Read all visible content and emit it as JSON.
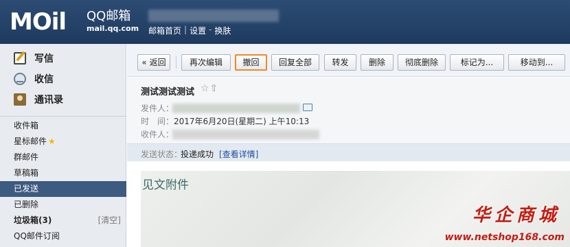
{
  "brand": {
    "logo": "MOil",
    "title": "QQ邮箱",
    "domain": "mail.qq.com"
  },
  "header": {
    "links": [
      "邮箱首页",
      "|",
      "设置",
      "-",
      "换肤"
    ]
  },
  "sidebar": {
    "actions": [
      {
        "label": "写信",
        "icon": "compose-icon"
      },
      {
        "label": "收信",
        "icon": "inbox-icon"
      },
      {
        "label": "通讯录",
        "icon": "contacts-icon"
      }
    ],
    "folders": [
      {
        "label": "收件箱"
      },
      {
        "label": "星标邮件",
        "star": "★"
      },
      {
        "label": "群邮件"
      },
      {
        "label": "草稿箱"
      },
      {
        "label": "已发送",
        "selected": true
      },
      {
        "label": "已删除"
      },
      {
        "label": "垃圾箱(3)",
        "action": "[清空]"
      },
      {
        "label": "QQ邮件订阅"
      }
    ]
  },
  "toolbar": {
    "back": "« 返回",
    "reedit": "再次编辑",
    "recall": "撤回",
    "reply_all": "回复全部",
    "forward": "转发",
    "delete": "删除",
    "delete_forever": "彻底删除",
    "mark_as": "标记为...",
    "move_to": "移动到..."
  },
  "message": {
    "subject": "测试测试测试",
    "subject_icons": "☆⇧",
    "sender_label": "发件人：",
    "time_label": "时　间：",
    "time_value": "2017年6月20日(星期二) 上午10:13",
    "recipient_label": "收件人：",
    "status_label": "发送状态：",
    "status_value": "投递成功",
    "status_link": "[查看详情]",
    "attachment_title": "见文附件"
  },
  "watermark": {
    "text": "华企商城",
    "url": "www.netshop168.com"
  },
  "colors": {
    "header": "#2d4c74",
    "selected": "#3d5a80",
    "highlight": "#f08a24",
    "watermark": "#c41d12"
  }
}
